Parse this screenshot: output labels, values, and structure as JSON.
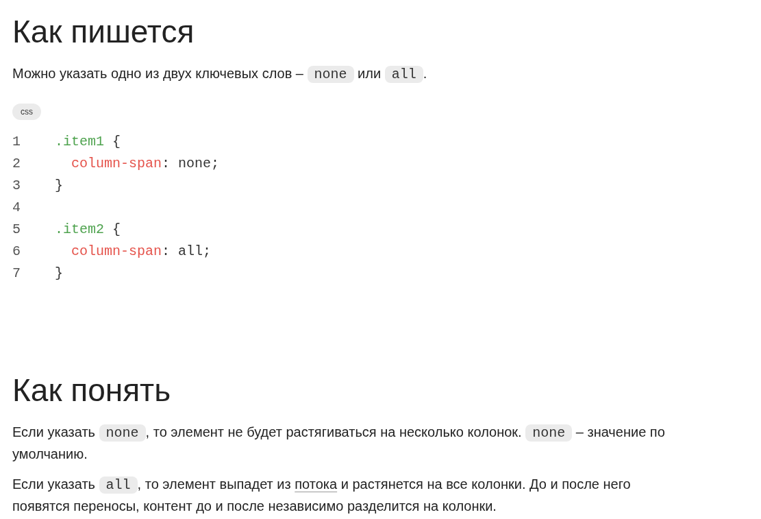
{
  "sections": [
    {
      "heading": "Как пишется",
      "paragraphs": [
        [
          {
            "kind": "text",
            "text": "Можно указать одно из двух ключевых слов – "
          },
          {
            "kind": "code",
            "text": "none"
          },
          {
            "kind": "text",
            "text": " или "
          },
          {
            "kind": "code",
            "text": "all"
          },
          {
            "kind": "text",
            "text": "."
          }
        ]
      ],
      "code_block": {
        "language": "css",
        "lines": [
          {
            "number": "1",
            "tokens": [
              {
                "kind": "selector",
                "text": ".item1"
              },
              {
                "kind": "plain",
                "text": " {"
              }
            ]
          },
          {
            "number": "2",
            "tokens": [
              {
                "kind": "property",
                "text": "  column-span"
              },
              {
                "kind": "plain",
                "text": ": none;"
              }
            ]
          },
          {
            "number": "3",
            "tokens": [
              {
                "kind": "plain",
                "text": "}"
              }
            ]
          },
          {
            "number": "4"
          },
          {
            "number": "5",
            "tokens": [
              {
                "kind": "selector",
                "text": ".item2"
              },
              {
                "kind": "plain",
                "text": " {"
              }
            ]
          },
          {
            "number": "6",
            "tokens": [
              {
                "kind": "property",
                "text": "  column-span"
              },
              {
                "kind": "plain",
                "text": ": all;"
              }
            ]
          },
          {
            "number": "7",
            "tokens": [
              {
                "kind": "plain",
                "text": "}"
              }
            ]
          }
        ]
      }
    },
    {
      "heading": "Как понять",
      "paragraphs": [
        [
          {
            "kind": "text",
            "text": "Если указать "
          },
          {
            "kind": "code",
            "text": "none"
          },
          {
            "kind": "text",
            "text": ", то элемент не будет растягиваться на несколько колонок. "
          },
          {
            "kind": "code",
            "text": "none"
          },
          {
            "kind": "text",
            "text": " – значение по умолчанию."
          }
        ],
        [
          {
            "kind": "text",
            "text": "Если указать "
          },
          {
            "kind": "code",
            "text": "all"
          },
          {
            "kind": "text",
            "text": ", то элемент выпадет из "
          },
          {
            "kind": "link",
            "text": "потока"
          },
          {
            "kind": "text",
            "text": " и растянется на все колонки. До и после него появятся переносы, контент до и после независимо разделится на колонки."
          }
        ]
      ]
    }
  ]
}
